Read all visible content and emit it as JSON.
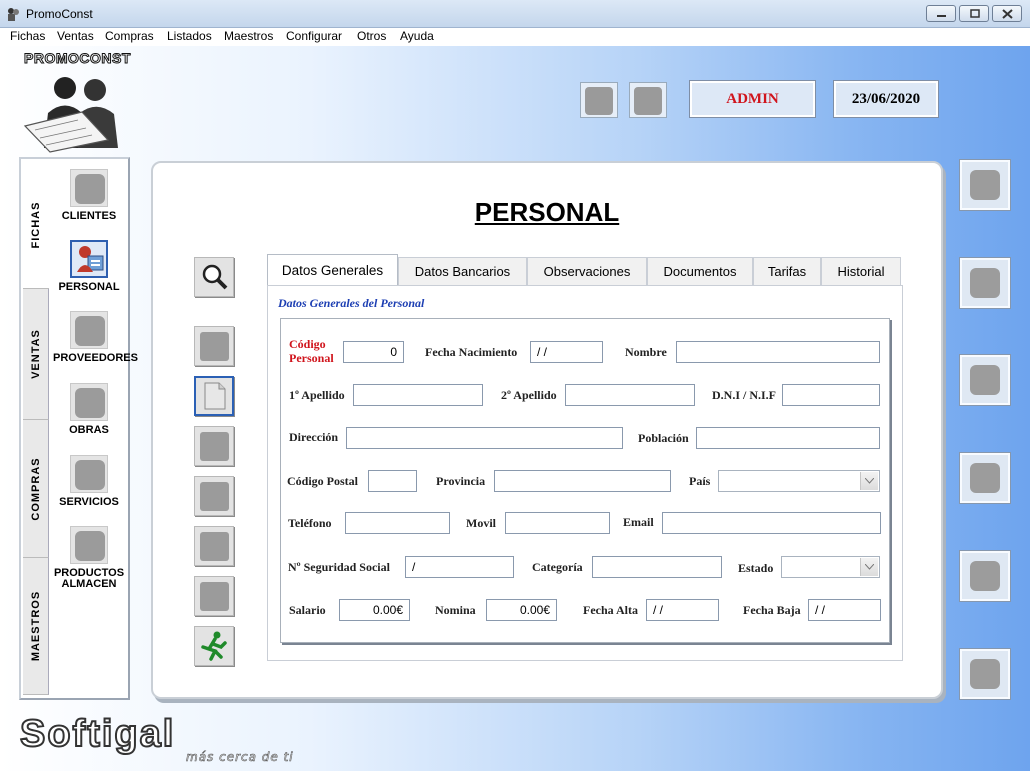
{
  "window": {
    "title": "PromoConst"
  },
  "menu": [
    "Fichas",
    "Ventas",
    "Compras",
    "Listados",
    "Maestros",
    "Configurar",
    "Otros",
    "Ayuda"
  ],
  "header": {
    "logo_text": "PROMOCONST",
    "user": "ADMIN",
    "date": "23/06/2020",
    "user_color": "#d0141c"
  },
  "sidebar": {
    "tabs": [
      "FICHAS",
      "VENTAS",
      "COMPRAS",
      "MAESTROS"
    ],
    "items": [
      "CLIENTES",
      "PERSONAL",
      "PROVEEDORES",
      "OBRAS",
      "SERVICIOS",
      "PRODUCTOS ALMACEN"
    ],
    "active_item": "PERSONAL"
  },
  "panel": {
    "title": "PERSONAL",
    "tabs": [
      "Datos Generales",
      "Datos Bancarios",
      "Observaciones",
      "Documentos",
      "Tarifas",
      "Historial"
    ],
    "subheading": "Datos Generales del Personal"
  },
  "form": {
    "codigo_label": "Código Personal",
    "codigo_value": "0",
    "fecha_nac_label": "Fecha Nacimiento",
    "fecha_nac_value": "/ /",
    "nombre_label": "Nombre",
    "apellido1_label": "1º Apellido",
    "apellido2_label": "2º Apellido",
    "dni_label": "D.N.I / N.I.F",
    "direccion_label": "Dirección",
    "poblacion_label": "Población",
    "cp_label": "Código Postal",
    "provincia_label": "Provincia",
    "pais_label": "País",
    "telefono_label": "Teléfono",
    "movil_label": "Movil",
    "email_label": "Email",
    "ss_label": "Nº Seguridad Social",
    "ss_value": "/",
    "categoria_label": "Categoría",
    "estado_label": "Estado",
    "salario_label": "Salario",
    "salario_value": "0.00€",
    "nomina_label": "Nomina",
    "nomina_value": "0.00€",
    "fecha_alta_label": "Fecha Alta",
    "fecha_alta_value": "/ /",
    "fecha_baja_label": "Fecha Baja",
    "fecha_baja_value": "/ /"
  },
  "footer": {
    "brand": "Softigal",
    "tagline": "más cerca de ti"
  }
}
